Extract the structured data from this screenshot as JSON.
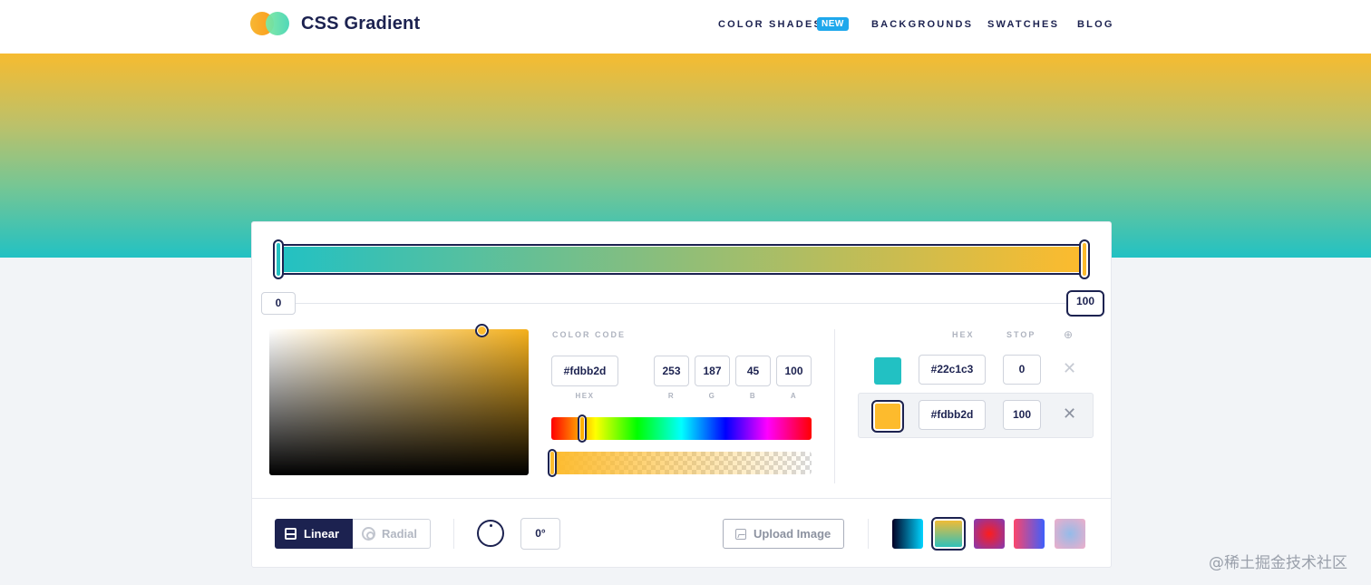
{
  "header": {
    "brand": "CSS Gradient",
    "nav": {
      "color_shades": "COLOR SHADES",
      "new_badge": "NEW",
      "backgrounds": "BACKGROUNDS",
      "swatches": "SWATCHES",
      "blog": "BLOG"
    }
  },
  "gradient": {
    "type": "linear",
    "angle": "0°",
    "stops": [
      {
        "hex": "#22c1c3",
        "position": "0"
      },
      {
        "hex": "#fdbb2d",
        "position": "100"
      }
    ],
    "active_stop": 1
  },
  "picker": {
    "color_code_label": "COLOR CODE",
    "hex_value": "#fdbb2d",
    "r": "253",
    "g": "187",
    "b": "45",
    "a": "100",
    "labels": {
      "hex": "HEX",
      "r": "R",
      "g": "G",
      "b": "B",
      "a": "A"
    }
  },
  "stop_list": {
    "col_hex": "HEX",
    "col_stop": "STOP",
    "add_icon": "⊕",
    "delete_icon": "✕"
  },
  "toolbar": {
    "linear": "Linear",
    "radial": "Radial",
    "angle": "0°",
    "upload": "Upload Image",
    "presets": [
      {
        "from": "#020024",
        "to": "#00d4ff"
      },
      {
        "from": "#fdbb2d",
        "to": "#22c1c3"
      },
      {
        "from": "#833ab4",
        "to": "#fd1d1d"
      },
      {
        "from": "#fc466b",
        "to": "#3f5efb"
      },
      {
        "from": "#eeaeca",
        "to": "#94bbe9"
      }
    ]
  },
  "watermark": "@稀土掘金技术社区",
  "colors": {
    "navy": "#1c2250",
    "badge": "#1fa8ec"
  }
}
